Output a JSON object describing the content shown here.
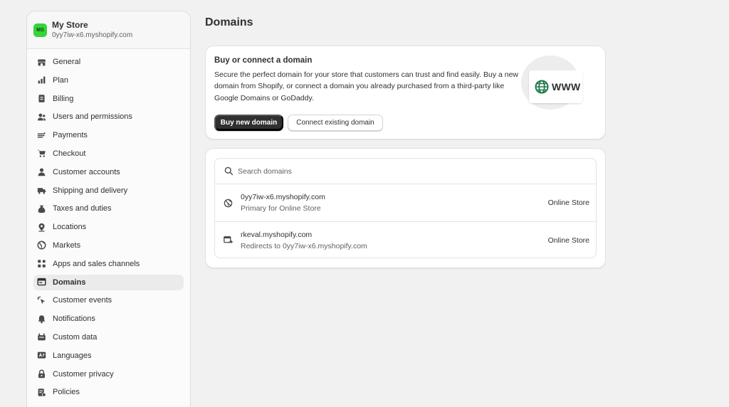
{
  "store": {
    "initials": "MS",
    "name": "My Store",
    "domain": "0yy7iw-x6.myshopify.com"
  },
  "sidebar": {
    "items": [
      {
        "label": "General",
        "icon": "store-icon"
      },
      {
        "label": "Plan",
        "icon": "plan-icon"
      },
      {
        "label": "Billing",
        "icon": "billing-icon"
      },
      {
        "label": "Users and permissions",
        "icon": "users-icon"
      },
      {
        "label": "Payments",
        "icon": "payments-icon"
      },
      {
        "label": "Checkout",
        "icon": "cart-icon"
      },
      {
        "label": "Customer accounts",
        "icon": "person-icon"
      },
      {
        "label": "Shipping and delivery",
        "icon": "truck-icon"
      },
      {
        "label": "Taxes and duties",
        "icon": "tax-icon"
      },
      {
        "label": "Locations",
        "icon": "location-icon"
      },
      {
        "label": "Markets",
        "icon": "globe-icon"
      },
      {
        "label": "Apps and sales channels",
        "icon": "apps-icon"
      },
      {
        "label": "Domains",
        "icon": "domains-icon",
        "active": true
      },
      {
        "label": "Customer events",
        "icon": "cursor-icon"
      },
      {
        "label": "Notifications",
        "icon": "bell-icon"
      },
      {
        "label": "Custom data",
        "icon": "database-icon"
      },
      {
        "label": "Languages",
        "icon": "language-icon"
      },
      {
        "label": "Customer privacy",
        "icon": "lock-icon"
      },
      {
        "label": "Policies",
        "icon": "policy-icon"
      }
    ]
  },
  "main": {
    "title": "Domains",
    "buy_card": {
      "title": "Buy or connect a domain",
      "description": "Secure the perfect domain for your store that customers can trust and find easily. Buy a new domain from Shopify, or connect a domain you already purchased from a third-party like Google Domains or GoDaddy.",
      "buy_button": "Buy new domain",
      "connect_button": "Connect existing domain",
      "illustration_text": "WWW"
    },
    "domains": {
      "search_placeholder": "Search domains",
      "rows": [
        {
          "name": "0yy7iw-x6.myshopify.com",
          "sub": "Primary for Online Store",
          "channel": "Online Store",
          "icon": "primary-domain-icon"
        },
        {
          "name": "rkeval.myshopify.com",
          "sub": "Redirects to 0yy7iw-x6.myshopify.com",
          "channel": "Online Store",
          "icon": "redirect-domain-icon"
        }
      ]
    }
  },
  "colors": {
    "avatar": "#36d33a",
    "primary_button": "#303030",
    "page_bg": "#f1f1f1",
    "globe_green": "#1f7a4c"
  }
}
